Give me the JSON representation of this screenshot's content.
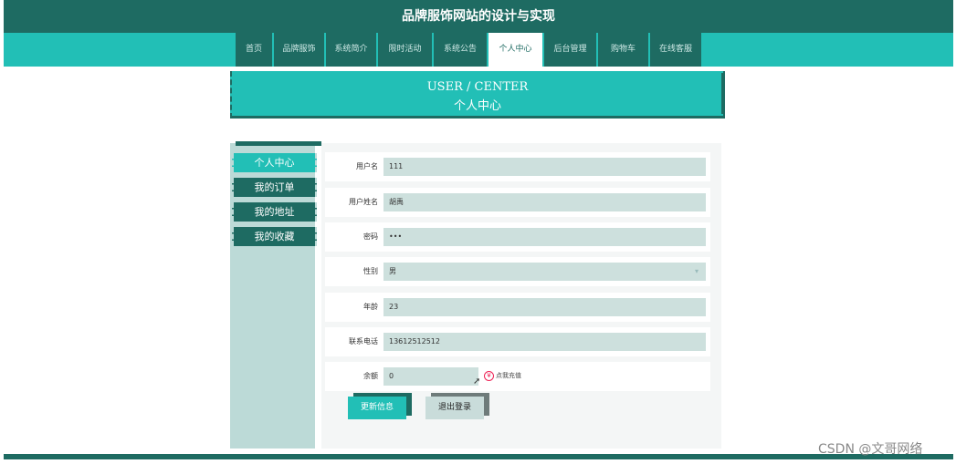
{
  "site_title": "品牌服饰网站的设计与实现",
  "nav": [
    "首页",
    "品牌服饰",
    "系统简介",
    "限时活动",
    "系统公告",
    "个人中心",
    "后台管理",
    "购物车",
    "在线客服"
  ],
  "nav_active_index": 5,
  "banner": {
    "en": "USER / CENTER",
    "cn": "个人中心"
  },
  "sidebar": [
    "个人中心",
    "我的订单",
    "我的地址",
    "我的收藏"
  ],
  "form": {
    "username": {
      "label": "用户名",
      "value": "111"
    },
    "realname": {
      "label": "用户姓名",
      "value": "胡禹"
    },
    "password": {
      "label": "密码",
      "value": "•••"
    },
    "gender": {
      "label": "性别",
      "value": "男"
    },
    "age": {
      "label": "年龄",
      "value": "23"
    },
    "phone": {
      "label": "联系电话",
      "value": "13612512512"
    },
    "balance": {
      "label": "余额",
      "value": "0"
    }
  },
  "recharge_label": "点我充值",
  "buttons": {
    "update": "更新信息",
    "logout": "退出登录"
  },
  "watermark": "CSDN @文哥网络"
}
